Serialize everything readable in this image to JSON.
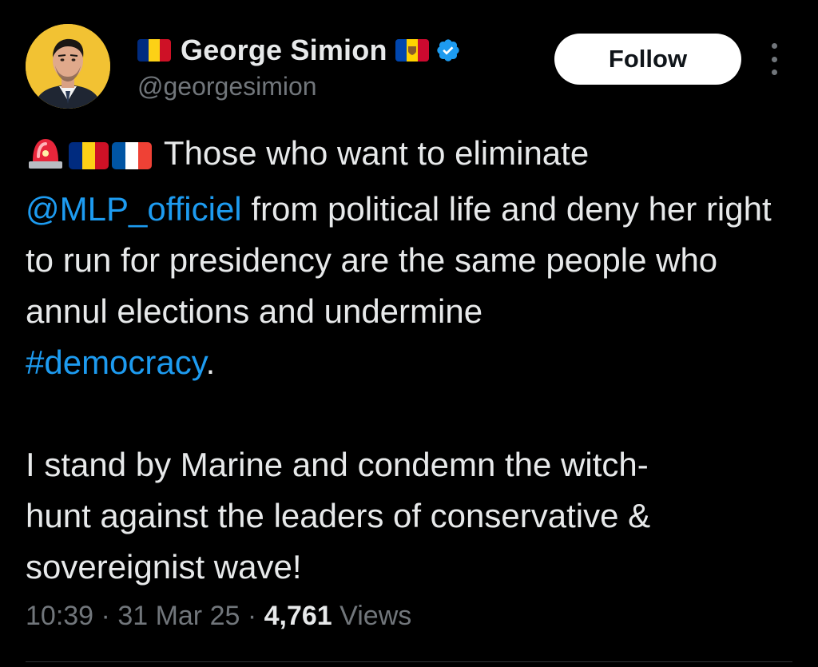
{
  "author": {
    "display_name": "George Simion",
    "handle": "@georgesimion",
    "verified": true,
    "flags": [
      "romania-flag",
      "moldova-flag"
    ],
    "avatar": "avatar"
  },
  "actions": {
    "follow_label": "Follow",
    "more_icon": "more-vertical-icon"
  },
  "tweet": {
    "line1_text": " Those who want to eliminate",
    "mention": "@MLP_officiel",
    "line2_text": " from political life and deny her right to run for presidency are the same people who annul elections and undermine",
    "hashtag": "#democracy",
    "line2_end": ".",
    "paragraph2": "I stand by Marine and condemn the witch-hunt against the leaders of conservative & sovereignist wave!",
    "leading_emojis": [
      "siren-emoji",
      "romania-flag",
      "france-flag"
    ]
  },
  "meta": {
    "time": "10:39",
    "date": "31 Mar 25",
    "sep": " · ",
    "views_count": "4,761",
    "views_label": "Views"
  },
  "colors": {
    "background": "#000000",
    "text": "#e7e9ea",
    "muted": "#71767b",
    "link": "#1d9bf0",
    "verified": "#1d9bf0",
    "follow_bg": "#ffffff",
    "avatar_bg": "#f2c233"
  }
}
